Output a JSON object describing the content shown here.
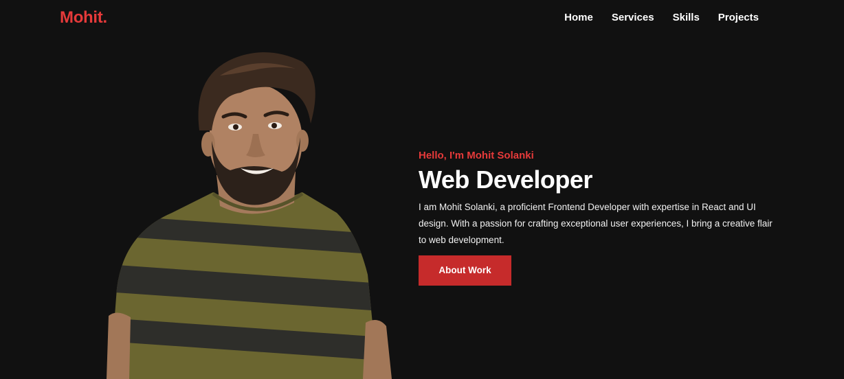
{
  "brand": {
    "logo": "Mohit."
  },
  "nav": {
    "items": [
      {
        "label": "Home"
      },
      {
        "label": "Services"
      },
      {
        "label": "Skills"
      },
      {
        "label": "Projects"
      }
    ]
  },
  "hero": {
    "greeting": "Hello, I'm Mohit Solanki",
    "title": "Web Developer",
    "description": "I am Mohit Solanki, a proficient Frontend Developer with expertise in React and UI design. With a passion for crafting exceptional user experiences, I bring a creative flair to web development.",
    "cta_label": "About Work"
  },
  "colors": {
    "background": "#111111",
    "accent": "#e63a3a",
    "button": "#c62b2b",
    "text": "#ffffff"
  }
}
